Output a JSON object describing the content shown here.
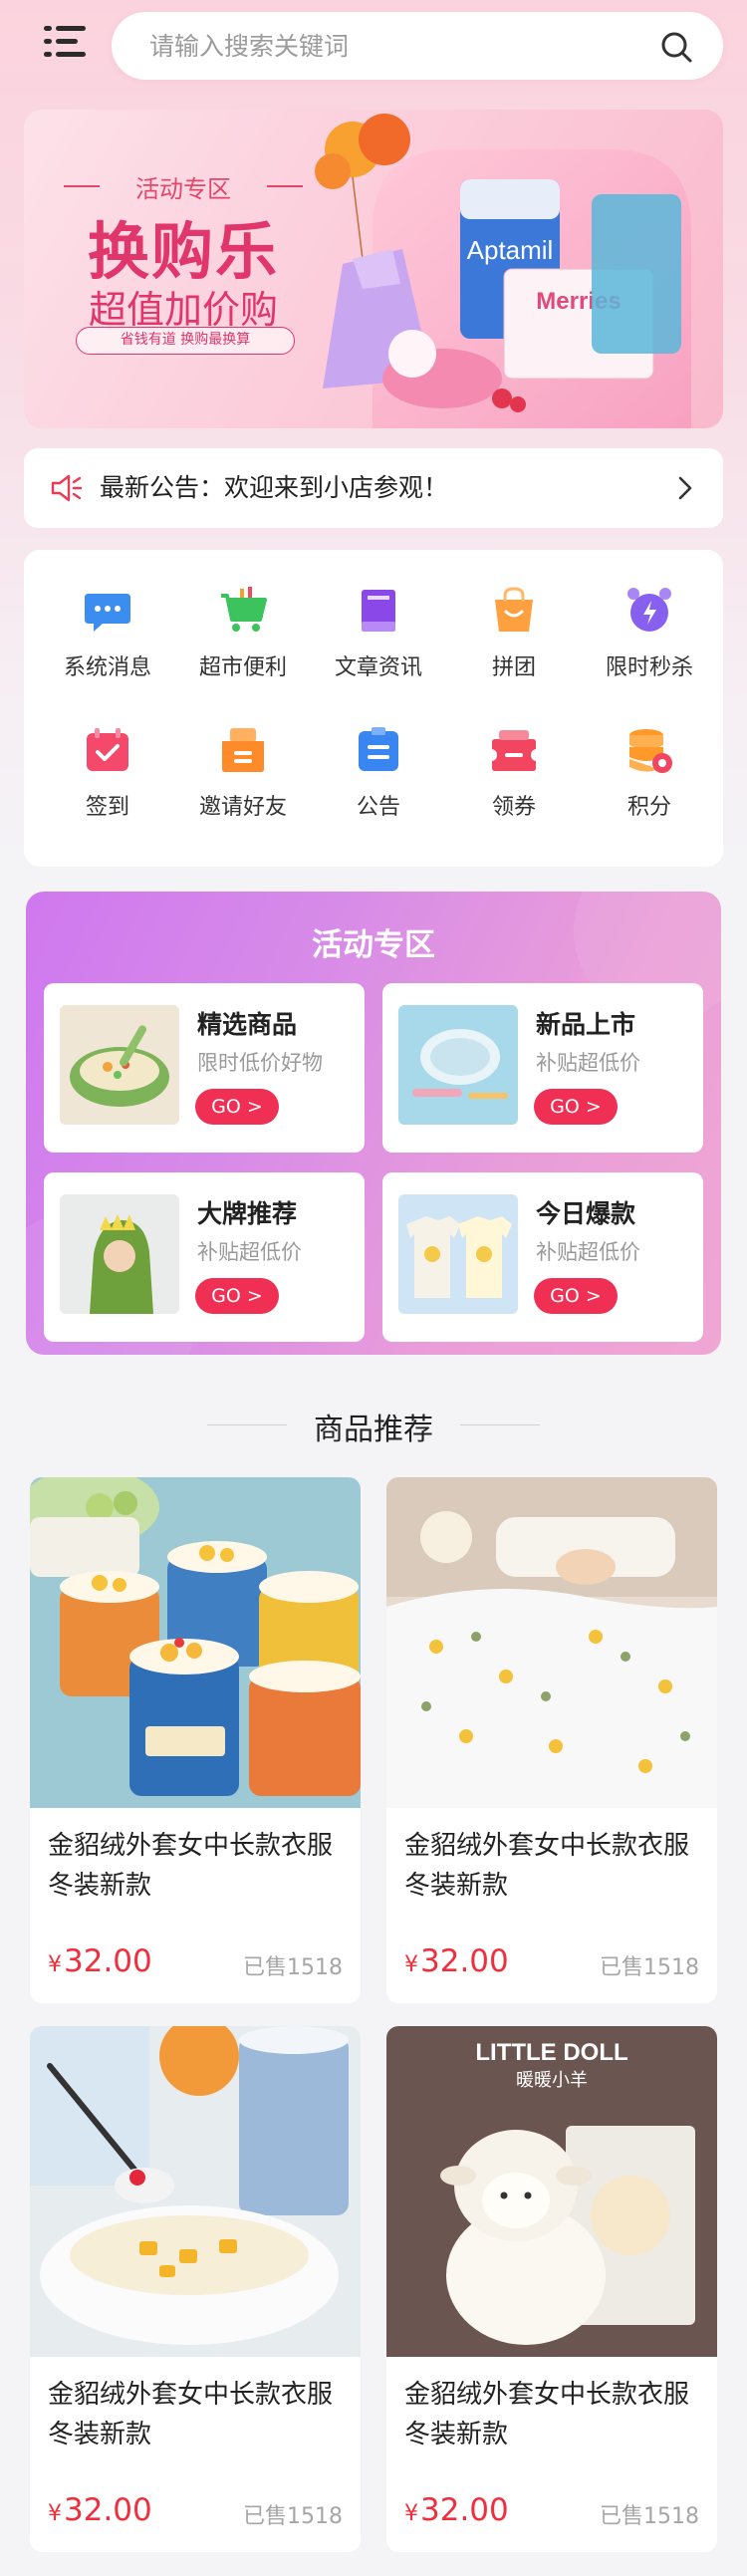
{
  "search": {
    "placeholder": "请输入搜索关键词"
  },
  "banner": {
    "tag": "活动专区",
    "headline": "换购乐",
    "subline": "超值加价购",
    "pill": "省钱有道 换购最换算",
    "product_brands": [
      "Aptamil",
      "Merries"
    ]
  },
  "notice": {
    "text": "最新公告：欢迎来到小店参观！"
  },
  "menu": {
    "items": [
      {
        "label": "系统消息",
        "icon": "message-icon",
        "color": "#3b8ef0"
      },
      {
        "label": "超市便利",
        "icon": "cart-icon",
        "color": "#3cc35e"
      },
      {
        "label": "文章资讯",
        "icon": "book-icon",
        "color": "#8a48e8"
      },
      {
        "label": "拼团",
        "icon": "bag-icon",
        "color": "#ffa040"
      },
      {
        "label": "限时秒杀",
        "icon": "alarm-icon",
        "color": "#8860f0"
      },
      {
        "label": "签到",
        "icon": "calendar-check-icon",
        "color": "#f4496b"
      },
      {
        "label": "邀请好友",
        "icon": "invite-icon",
        "color": "#ff8a2a"
      },
      {
        "label": "公告",
        "icon": "notice-board-icon",
        "color": "#3a86f0"
      },
      {
        "label": "领券",
        "icon": "coupon-icon",
        "color": "#f2455f"
      },
      {
        "label": "积分",
        "icon": "coins-icon",
        "color": "#ff9a2a"
      }
    ]
  },
  "activity": {
    "title": "活动专区",
    "cards": [
      {
        "name": "精选商品",
        "desc": "限时低价好物",
        "go": "GO >"
      },
      {
        "name": "新品上市",
        "desc": "补贴超低价",
        "go": "GO >"
      },
      {
        "name": "大牌推荐",
        "desc": "补贴超低价",
        "go": "GO >"
      },
      {
        "name": "今日爆款",
        "desc": "补贴超低价",
        "go": "GO >"
      }
    ]
  },
  "recommend": {
    "heading": "商品推荐",
    "products": [
      {
        "title": "金貂绒外套女中长款衣服冬装新款",
        "currency": "¥",
        "price": "32.00",
        "sold": "已售1518"
      },
      {
        "title": "金貂绒外套女中长款衣服冬装新款",
        "currency": "¥",
        "price": "32.00",
        "sold": "已售1518"
      },
      {
        "title": "金貂绒外套女中长款衣服冬装新款",
        "currency": "¥",
        "price": "32.00",
        "sold": "已售1518"
      },
      {
        "title": "金貂绒外套女中长款衣服冬装新款",
        "currency": "¥",
        "price": "32.00",
        "sold": "已售1518",
        "image_text": "LITTLE DOLL",
        "image_subtext": "暖暖小羊"
      }
    ]
  },
  "colors": {
    "accent": "#ef2f53",
    "price": "#ef2f3d",
    "activity_gradient": [
      "#cf78ef",
      "#f0a7d3"
    ]
  }
}
